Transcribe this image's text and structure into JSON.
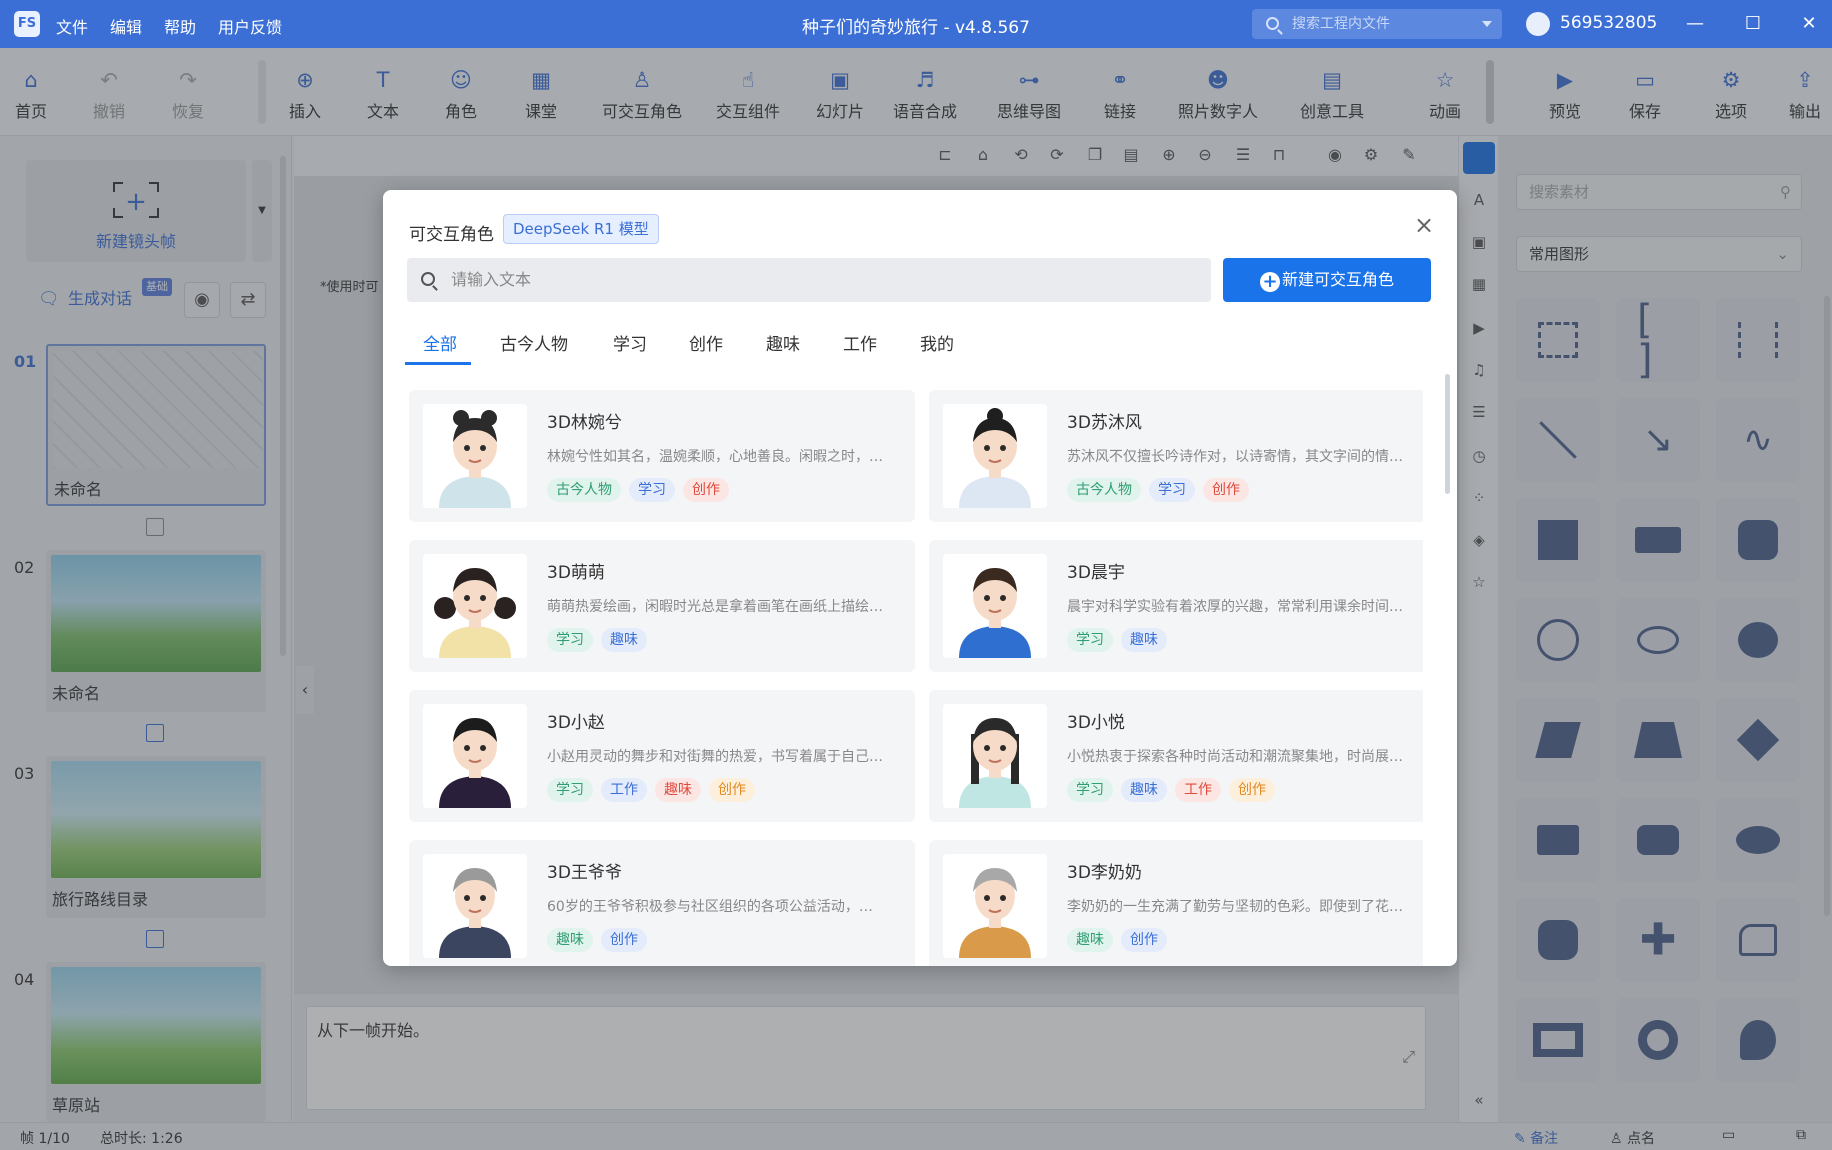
{
  "titlebar": {
    "logo": "FS",
    "menus": [
      "文件",
      "编辑",
      "帮助",
      "用户反馈"
    ],
    "title": "种子们的奇妙旅行 - v4.8.567",
    "search_placeholder": "搜索工程内文件",
    "user_id": "569532805",
    "window_controls": [
      "—",
      "☐",
      "✕"
    ]
  },
  "ribbon": {
    "items": [
      {
        "label": "首页",
        "icon": "⌂",
        "disabled": false
      },
      {
        "label": "撤销",
        "icon": "↶",
        "disabled": true
      },
      {
        "label": "恢复",
        "icon": "↷",
        "disabled": true
      },
      {
        "label": "插入",
        "icon": "⊕",
        "disabled": false
      },
      {
        "label": "文本",
        "icon": "T",
        "disabled": false
      },
      {
        "label": "角色",
        "icon": "☺",
        "disabled": false
      },
      {
        "label": "课堂",
        "icon": "▦",
        "disabled": false
      },
      {
        "label": "可交互角色",
        "icon": "♙",
        "disabled": false
      },
      {
        "label": "交互组件",
        "icon": "☝",
        "disabled": false
      },
      {
        "label": "幻灯片",
        "icon": "▣",
        "disabled": false
      },
      {
        "label": "语音合成",
        "icon": "♬",
        "disabled": false
      },
      {
        "label": "思维导图",
        "icon": "⊶",
        "disabled": false
      },
      {
        "label": "链接",
        "icon": "⚭",
        "disabled": false
      },
      {
        "label": "照片数字人",
        "icon": "☻",
        "disabled": false
      },
      {
        "label": "创意工具",
        "icon": "▤",
        "disabled": false
      },
      {
        "label": "动画",
        "icon": "☆",
        "disabled": false
      },
      {
        "label": "预览",
        "icon": "▶",
        "disabled": false
      },
      {
        "label": "保存",
        "icon": "▭",
        "disabled": false
      },
      {
        "label": "选项",
        "icon": "⚙",
        "disabled": false
      },
      {
        "label": "输出",
        "icon": "⇪",
        "disabled": false
      }
    ]
  },
  "left_panel": {
    "new_shot_label": "新建镜头帧",
    "gen_dialog_label": "生成对话",
    "gen_badge": "基础",
    "frames": [
      {
        "num": "01",
        "label": "未命名"
      },
      {
        "num": "02",
        "label": "未命名"
      },
      {
        "num": "03",
        "label": "旅行路线目录"
      },
      {
        "num": "04",
        "label": "草原站"
      }
    ]
  },
  "canvas": {
    "stage_hint": "*使用时可",
    "notes_text": "从下一帧开始。"
  },
  "right_panel": {
    "search_placeholder": "搜索素材",
    "category": "常用图形"
  },
  "status": {
    "frame_info": "帧 1/10",
    "duration": "总时长: 1:26",
    "notes_label": "备注",
    "roll_label": "点名"
  },
  "modal": {
    "title": "可交互角色",
    "model_tag": "DeepSeek R1 模型",
    "search_placeholder": "请输入文本",
    "new_button": "新建可交互角色",
    "tabs": [
      "全部",
      "古今人物",
      "学习",
      "创作",
      "趣味",
      "工作",
      "我的"
    ],
    "active_tab": "全部",
    "characters": [
      {
        "name": "3D林婉兮",
        "desc": "林婉兮性如其名，温婉柔顺，心地善良。闲暇之时，…",
        "tags": [
          [
            "古今人物",
            "green"
          ],
          [
            "学习",
            "blue"
          ],
          [
            "创作",
            "red"
          ]
        ],
        "hair": "#2b2b2b",
        "cloth": "#cfe3ea",
        "style": "girl-bun"
      },
      {
        "name": "3D苏沐风",
        "desc": "苏沐风不仅擅长吟诗作对，以诗寄情，其文字间的情…",
        "tags": [
          [
            "古今人物",
            "green"
          ],
          [
            "学习",
            "blue"
          ],
          [
            "创作",
            "red"
          ]
        ],
        "hair": "#1f1f1f",
        "cloth": "#dde7f3",
        "style": "boy-bun"
      },
      {
        "name": "3D萌萌",
        "desc": "萌萌热爱绘画，闲暇时光总是拿着画笔在画纸上描绘…",
        "tags": [
          [
            "学习",
            "green"
          ],
          [
            "趣味",
            "blue"
          ]
        ],
        "hair": "#2a2220",
        "cloth": "#f3e2a8",
        "style": "girl-pigtail"
      },
      {
        "name": "3D晨宇",
        "desc": "晨宇对科学实验有着浓厚的兴趣，常常利用课余时间…",
        "tags": [
          [
            "学习",
            "green"
          ],
          [
            "趣味",
            "blue"
          ]
        ],
        "hair": "#3a2a20",
        "cloth": "#2f6fd0",
        "style": "boy"
      },
      {
        "name": "3D小赵",
        "desc": "小赵用灵动的舞步和对街舞的热爱，书写着属于自己…",
        "tags": [
          [
            "学习",
            "green"
          ],
          [
            "工作",
            "blue"
          ],
          [
            "趣味",
            "red"
          ],
          [
            "创作",
            "orange"
          ]
        ],
        "hair": "#1c1c1c",
        "cloth": "#2a1f3a",
        "style": "teen"
      },
      {
        "name": "3D小悦",
        "desc": "小悦热衷于探索各种时尚活动和潮流聚集地，时尚展…",
        "tags": [
          [
            "学习",
            "green"
          ],
          [
            "趣味",
            "blue"
          ],
          [
            "工作",
            "red"
          ],
          [
            "创作",
            "orange"
          ]
        ],
        "hair": "#2a2a2a",
        "cloth": "#bfe6e3",
        "style": "teen-girl"
      },
      {
        "name": "3D王爷爷",
        "desc": "60岁的王爷爷积极参与社区组织的各项公益活动，…",
        "tags": [
          [
            "趣味",
            "green"
          ],
          [
            "创作",
            "blue"
          ]
        ],
        "hair": "#9a9a9a",
        "cloth": "#3c4560",
        "style": "old-man"
      },
      {
        "name": "3D李奶奶",
        "desc": "李奶奶的一生充满了勤劳与坚韧的色彩。即使到了花…",
        "tags": [
          [
            "趣味",
            "green"
          ],
          [
            "创作",
            "blue"
          ]
        ],
        "hair": "#a8a8a8",
        "cloth": "#d99a4a",
        "style": "old-woman"
      }
    ]
  }
}
